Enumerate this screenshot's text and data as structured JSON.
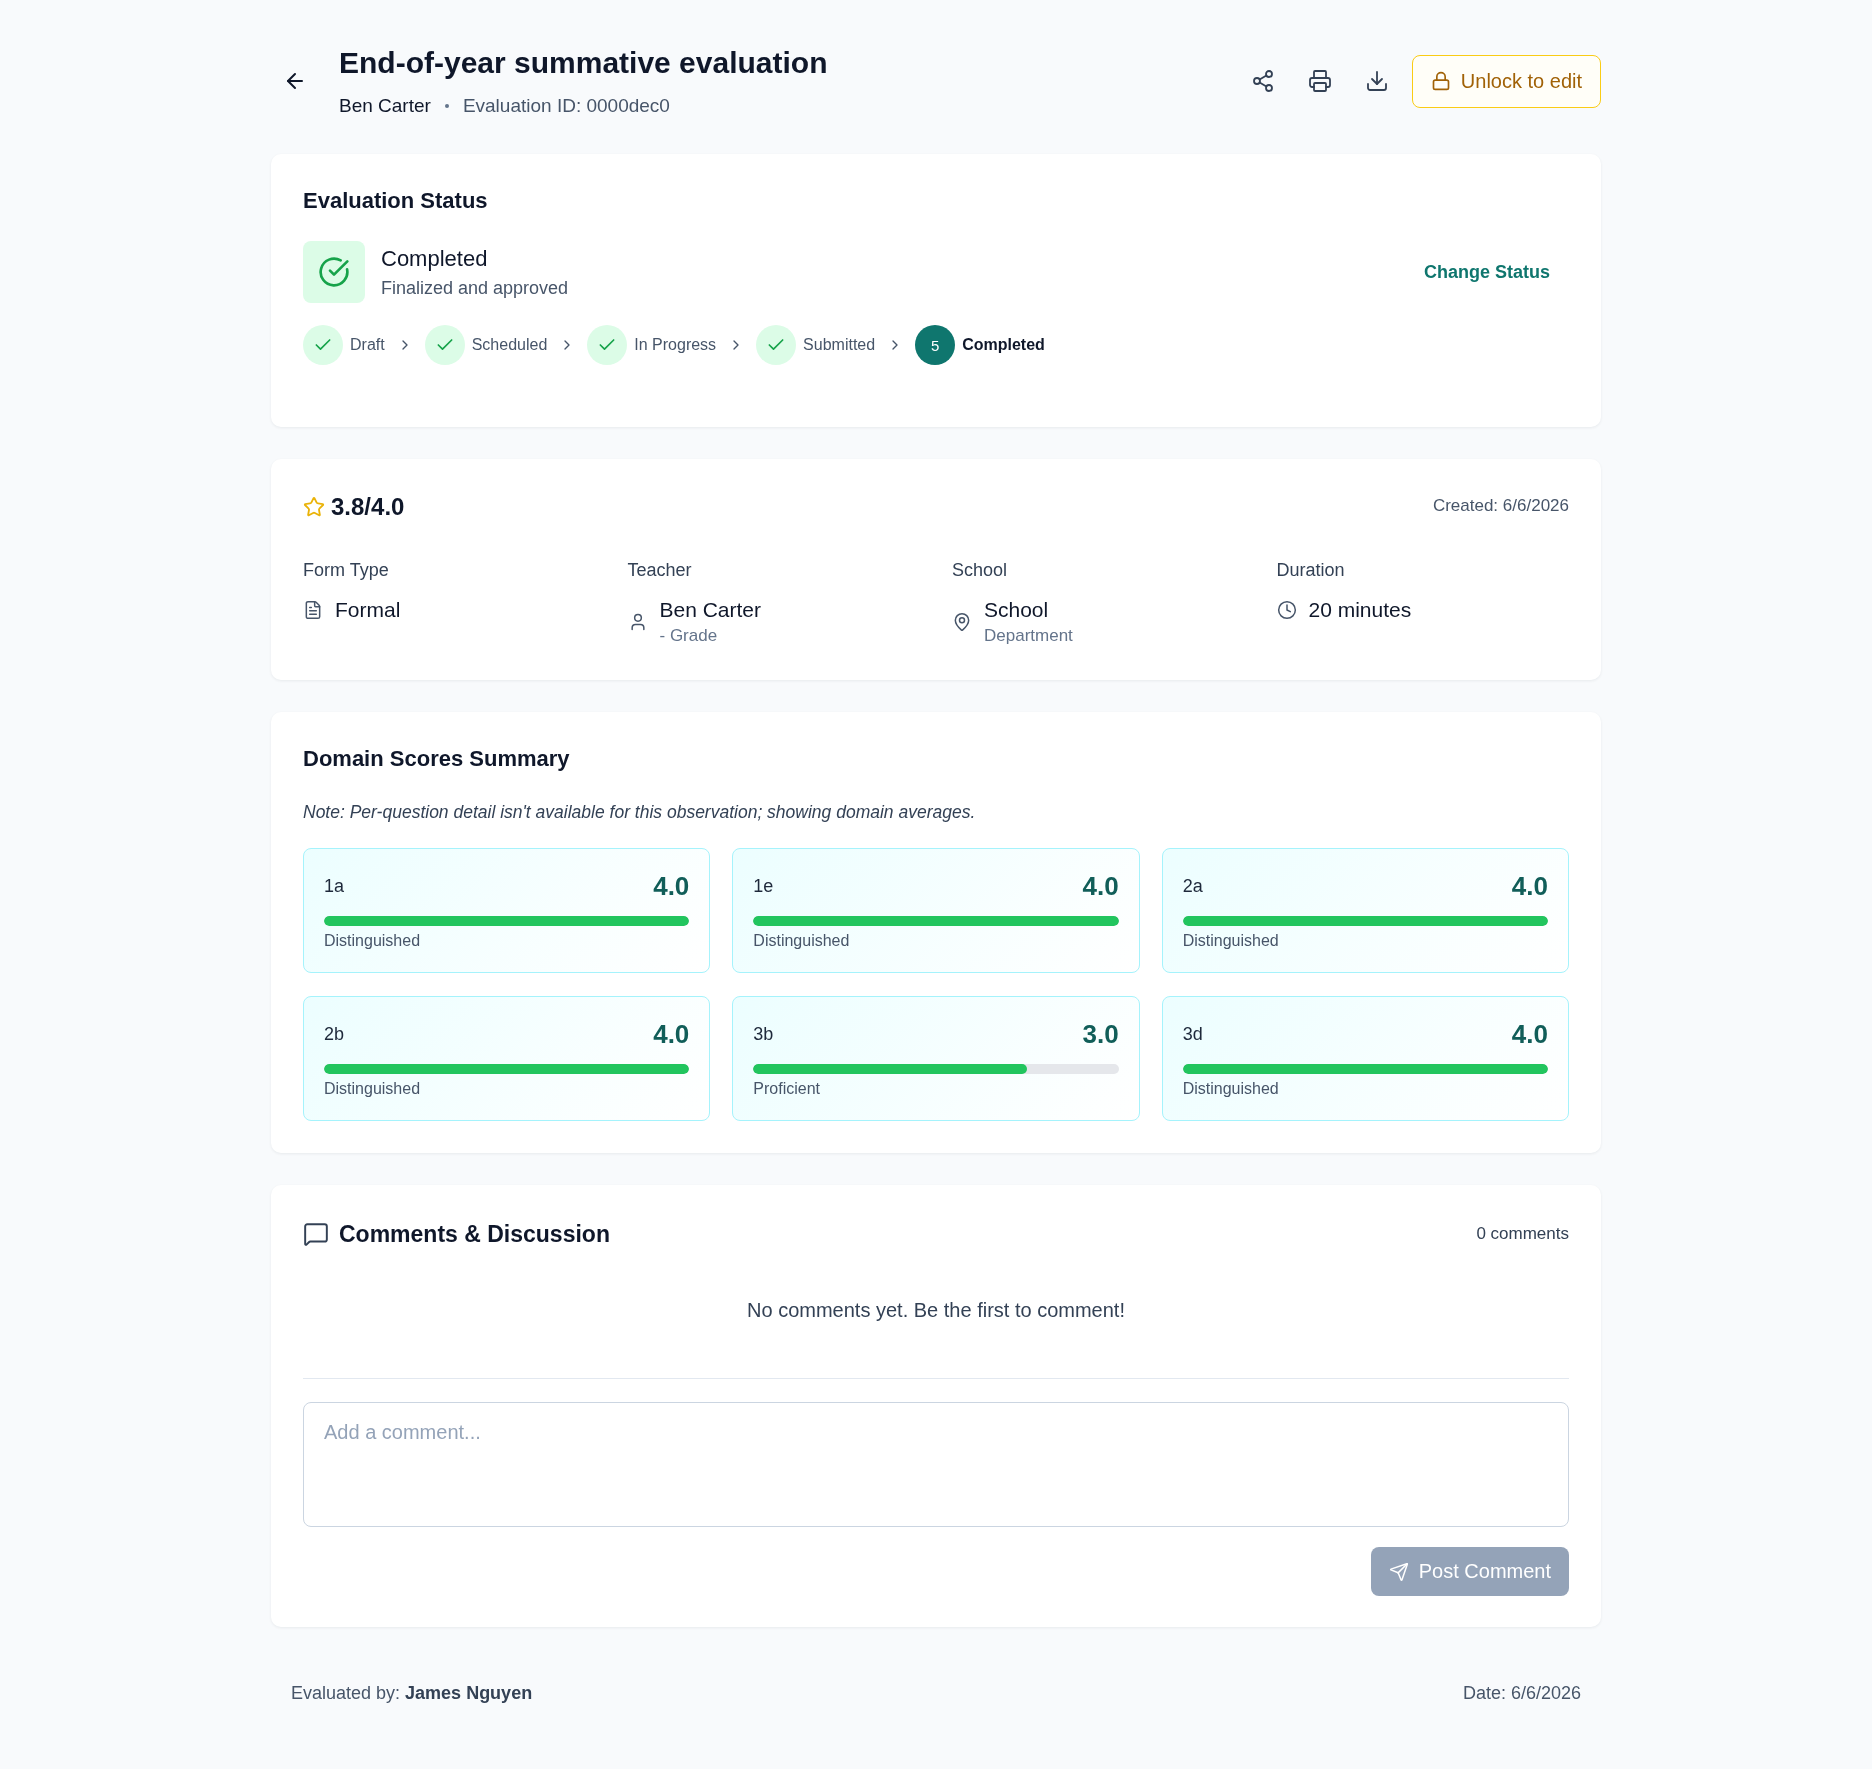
{
  "header": {
    "title": "End-of-year summative evaluation",
    "teacher_name": "Ben Carter",
    "evaluation_id": "Evaluation ID: 0000dec0",
    "unlock_button": "Unlock to edit"
  },
  "status": {
    "heading": "Evaluation Status",
    "current": "Completed",
    "description": "Finalized and approved",
    "change_link": "Change Status",
    "steps": [
      {
        "label": "Draft",
        "done": true,
        "current": false
      },
      {
        "label": "Scheduled",
        "done": true,
        "current": false
      },
      {
        "label": "In Progress",
        "done": true,
        "current": false
      },
      {
        "label": "Submitted",
        "done": true,
        "current": false
      },
      {
        "label": "Completed",
        "number": "5",
        "done": false,
        "current": true
      }
    ]
  },
  "summary": {
    "rating": "3.8/4.0",
    "created": "Created: 6/6/2026",
    "fields": [
      {
        "label": "Form Type",
        "value": "Formal",
        "kind": "document"
      },
      {
        "label": "Teacher",
        "value": "Ben Carter",
        "detail": "- Grade",
        "kind": "person"
      },
      {
        "label": "School",
        "value": "School",
        "detail": "Department",
        "kind": "location"
      },
      {
        "label": "Duration",
        "value": "20 minutes",
        "kind": "clock"
      }
    ]
  },
  "domains": {
    "heading": "Domain Scores Summary",
    "note": "Note: Per-question detail isn't available for this observation; showing domain averages.",
    "items": [
      {
        "code": "1a",
        "score": "4.0",
        "level": 1,
        "rating": "Distinguished"
      },
      {
        "code": "1e",
        "score": "4.0",
        "level": 1,
        "rating": "Distinguished"
      },
      {
        "code": "2a",
        "score": "4.0",
        "level": 1,
        "rating": "Distinguished"
      },
      {
        "code": "2b",
        "score": "4.0",
        "level": 1,
        "rating": "Distinguished"
      },
      {
        "code": "3b",
        "score": "3.0",
        "level": 0.75,
        "rating": "Proficient"
      },
      {
        "code": "3d",
        "score": "4.0",
        "level": 1,
        "rating": "Distinguished"
      }
    ]
  },
  "comments": {
    "heading": "Comments & Discussion",
    "count": "0 comments",
    "empty_message": "No comments yet. Be the first to comment!",
    "input": {
      "placeholder": "Add a comment..."
    },
    "post_button": {
      "label": "Post Comment",
      "disabled": true
    }
  },
  "footer": {
    "evaluated_by": "Evaluated by: **James Nguyen**",
    "date": "Date: 6/6/2026"
  }
}
